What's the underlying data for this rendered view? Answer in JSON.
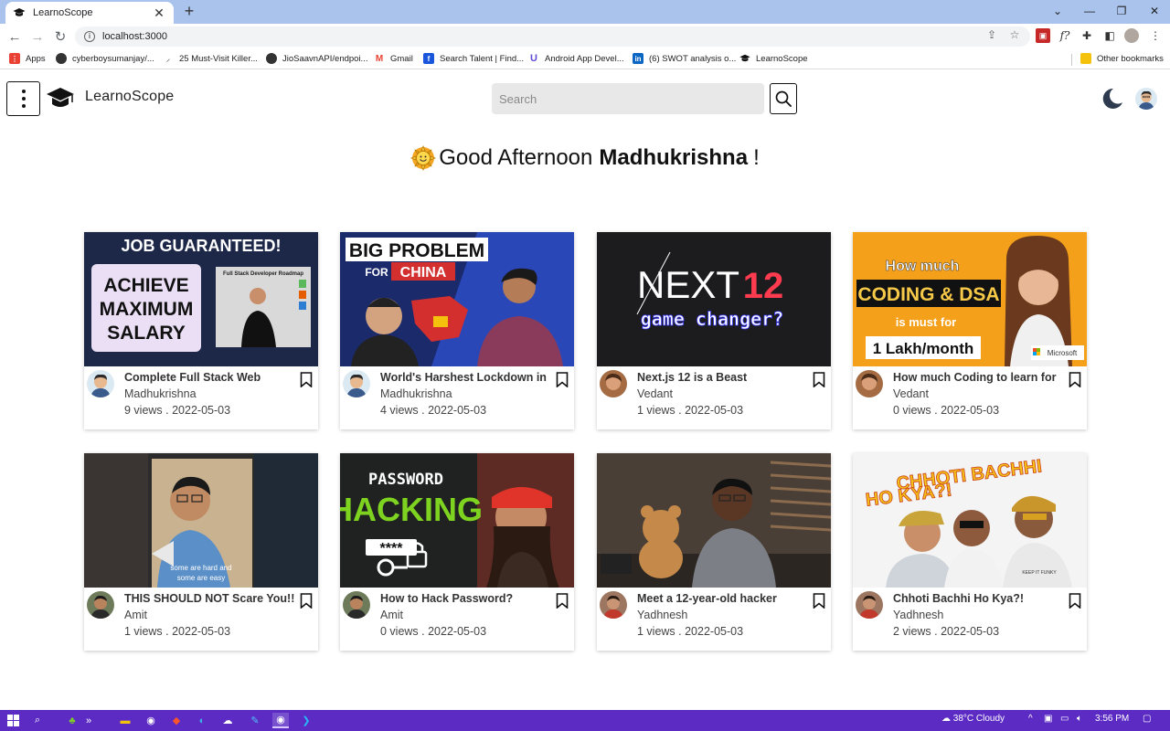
{
  "browser": {
    "tab_title": "LearnoScope",
    "url": "localhost:3000",
    "bookmarks": [
      {
        "label": "Apps",
        "color": "#e94235"
      },
      {
        "label": "cyberboysumanjay/...",
        "color": "#333333"
      },
      {
        "label": "25 Must-Visit Killer...",
        "color": "#6d6d6d"
      },
      {
        "label": "JioSaavnAPI/endpoi...",
        "color": "#333333"
      },
      {
        "label": "Gmail",
        "color": "#ea4335"
      },
      {
        "label": "Search Talent | Find...",
        "color": "#1a56db"
      },
      {
        "label": "Android App Devel...",
        "color": "#5b4bd8"
      },
      {
        "label": "(6) SWOT analysis o...",
        "color": "#0a66c2"
      },
      {
        "label": "LearnoScope",
        "color": "#222222"
      }
    ],
    "other_bookmarks": "Other bookmarks"
  },
  "header": {
    "brand": "LearnoScope",
    "search_placeholder": "Search"
  },
  "greeting": {
    "text": "Good Afternoon",
    "name": "Madhukrishna",
    "suffix": "!"
  },
  "videos": [
    {
      "title": "Complete Full Stack Web",
      "author": "Madhukrishna",
      "stats": "9 views . 2022-05-03",
      "thumb_text": [
        "JOB GUARANTEED!",
        "ACHIEVE",
        "MAXIMUM",
        "SALARY",
        "Full Stack Developer Roadmap"
      ]
    },
    {
      "title": "World's Harshest Lockdown in",
      "author": "Madhukrishna",
      "stats": "4 views . 2022-05-03",
      "thumb_text": [
        "BIG PROBLEM",
        "FOR",
        "CHINA"
      ]
    },
    {
      "title": "Next.js 12 is a Beast",
      "author": "Vedant",
      "stats": "1 views . 2022-05-03",
      "thumb_text": [
        "NEXT",
        "12",
        "game changer?"
      ]
    },
    {
      "title": "How much Coding to learn for",
      "author": "Vedant",
      "stats": "0 views . 2022-05-03",
      "thumb_text": [
        "How much",
        "CODING & DSA",
        "is must for",
        "1 Lakh/month",
        "Microsoft"
      ]
    },
    {
      "title": "THIS SHOULD NOT Scare You!!",
      "author": "Amit",
      "stats": "1 views . 2022-05-03",
      "thumb_text": [
        "some are hard and",
        "some are easy"
      ]
    },
    {
      "title": "How to Hack Password?",
      "author": "Amit",
      "stats": "0 views . 2022-05-03",
      "thumb_text": [
        "PASSWORD",
        "HACKING",
        "****"
      ]
    },
    {
      "title": "Meet a 12-year-old hacker",
      "author": "Yadhnesh",
      "stats": "1 views . 2022-05-03",
      "thumb_text": []
    },
    {
      "title": "Chhoti Bachhi Ho Kya?!",
      "author": "Yadhnesh",
      "stats": "2 views . 2022-05-03",
      "thumb_text": [
        "CHHOTI BACHHI",
        "HO KYA?!",
        "KEEP IT FUNKY"
      ]
    }
  ],
  "taskbar": {
    "weather": "38°C  Cloudy",
    "time": "3:56 PM"
  },
  "colors": {
    "accent": "#5b2bc4",
    "moon": "#2e3b4e",
    "tabstrip": "#a9c3ec"
  }
}
